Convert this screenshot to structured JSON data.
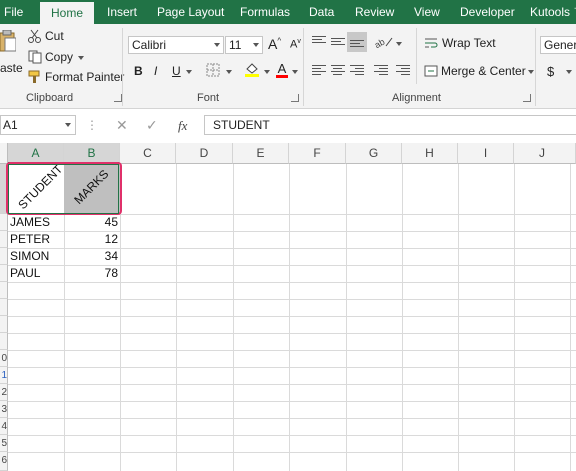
{
  "tabs": [
    "File",
    "Home",
    "Insert",
    "Page Layout",
    "Formulas",
    "Data",
    "Review",
    "View",
    "Developer",
    "Kutools ™"
  ],
  "clipboard": {
    "paste_label": "aste",
    "cut_label": "Cut",
    "copy_label": "Copy",
    "format_painter_label": "Format Painter",
    "group_label": "Clipboard"
  },
  "font": {
    "name": "Calibri",
    "size": "11",
    "grow": "A",
    "shrink": "A",
    "bold": "B",
    "italic": "I",
    "underline": "U",
    "color_letter": "A",
    "group_label": "Font",
    "fill_color": "#ffff00",
    "font_color": "#ff0000"
  },
  "alignment": {
    "wrap_text_label": "Wrap Text",
    "merge_center_label": "Merge & Center",
    "group_label": "Alignment"
  },
  "number": {
    "format": "Genera",
    "currency": "$"
  },
  "formula_bar": {
    "name_box": "A1",
    "fx": "fx",
    "content": "STUDENT"
  },
  "sheet": {
    "columns": [
      "A",
      "B",
      "C",
      "D",
      "E",
      "F",
      "G",
      "H",
      "I",
      "J"
    ],
    "header_row": {
      "a": "STUDENT",
      "b": "MARKS"
    },
    "rows": [
      {
        "name": "JAMES",
        "mark": "45"
      },
      {
        "name": "PETER",
        "mark": "12"
      },
      {
        "name": "SIMON",
        "mark": "34"
      },
      {
        "name": "PAUL",
        "mark": "78"
      }
    ],
    "row_numbers_partial": [
      "0",
      "1",
      "2",
      "3",
      "4",
      "5",
      "6"
    ]
  },
  "colors": {
    "accent": "#217346",
    "selection_outline": "#e0306a",
    "selected_fill": "#bfbfbf"
  }
}
